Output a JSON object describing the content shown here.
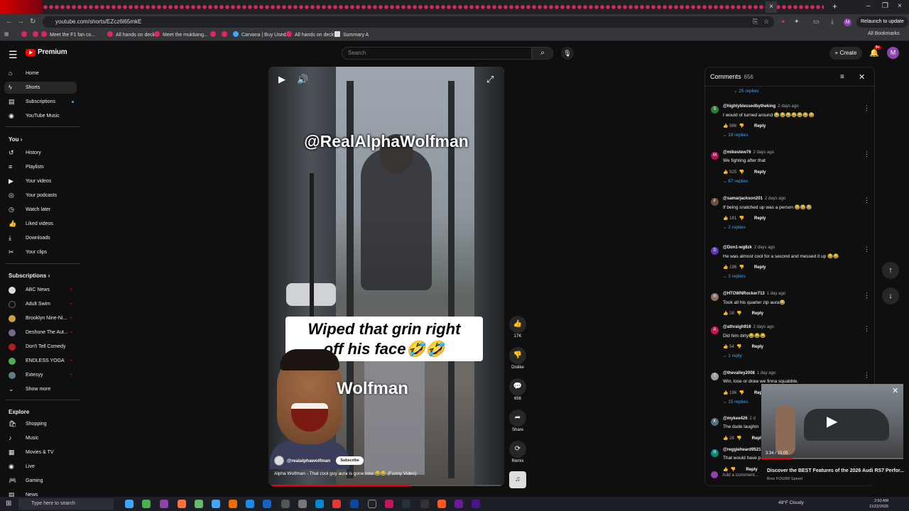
{
  "browser": {
    "url": "youtube.com/shorts/EZcz6l65mkE",
    "relaunch": "Relaunch to update",
    "profile": "M",
    "bookmarks": [
      "Meet the F1 fan co...",
      "All hands on deck",
      "Meet the mukbang...",
      "Carvana | Buy Used...",
      "All hands on deck",
      "Summary A"
    ],
    "all_bookmarks": "All Bookmarks"
  },
  "header": {
    "brand": "Premium",
    "search_placeholder": "Search",
    "create": "Create",
    "notif_count": "9+",
    "avatar": "M"
  },
  "sidebar": {
    "main": [
      "Home",
      "Shorts",
      "Subscriptions",
      "YouTube Music"
    ],
    "you_heading": "You",
    "you": [
      "History",
      "Playlists",
      "Your videos",
      "Your podcasts",
      "Watch later",
      "Liked videos",
      "Downloads",
      "Your clips"
    ],
    "subs_heading": "Subscriptions",
    "subs": [
      "ABC News",
      "Adult Swim",
      "Brooklyn Nine-Ni...",
      "Deshone The Aut...",
      "Don't Tell Comedy",
      "ENDLESS YOGA",
      "Extesyy"
    ],
    "show_more": "Show more",
    "explore_heading": "Explore",
    "explore": [
      "Shopping",
      "Music",
      "Movies & TV",
      "Live",
      "Gaming",
      "News"
    ]
  },
  "short": {
    "watermark": "@RealAlphaWolfman",
    "caption_line1": "Wiped that grin right",
    "caption_line2": "off his face🤣🤣",
    "overlay_name": "Wolfman",
    "channel": "@realalphawolfman",
    "subscribe": "Subscribe",
    "title": "Alpha Wolfman - That cool guy aura is gone now 😂😂 (Funny Video)",
    "progress": 0.6
  },
  "actions": {
    "likes": "17K",
    "dislike": "Dislike",
    "comments": "656",
    "share": "Share",
    "remix": "Remix"
  },
  "comments": {
    "title": "Comments",
    "count": "656",
    "reply_label": "Reply",
    "add_placeholder": "Add a comment...",
    "top_replies": "25 replies",
    "items": [
      {
        "user": "@highlyblessedbytheking",
        "age": "2 days ago",
        "text": "I would of turned around 😂😂😂😂😂😂😂",
        "likes": "986",
        "replies": "19 replies",
        "avatar": "S",
        "color": "#2e7d32"
      },
      {
        "user": "@mikestew76",
        "age": "2 days ago",
        "text": "We fighting after that",
        "likes": "925",
        "replies": "67 replies",
        "avatar": "M",
        "color": "#ad1457"
      },
      {
        "user": "@samarjackson201",
        "age": "2 days ago",
        "text": "If being snatched up was a person 😂😂😂",
        "likes": "181",
        "replies": "2 replies",
        "avatar": "F",
        "color": "#6d4c41"
      },
      {
        "user": "@Don1-wg8zk",
        "age": "2 days ago",
        "text": "He was almost cool for a second and messed it up 😂😂",
        "likes": "198",
        "replies": "3 replies",
        "avatar": "D",
        "color": "#5e35b1"
      },
      {
        "user": "@HTOWNRocker713",
        "age": "1 day ago",
        "text": "Took all his quarter zip aura😂",
        "likes": "28",
        "replies": "",
        "avatar": "H",
        "color": "#8d6e63"
      },
      {
        "user": "@athraigh916",
        "age": "2 days ago",
        "text": "Did him dirty😂😂😂",
        "likes": "54",
        "replies": "1 reply",
        "avatar": "A",
        "color": "#c2185b"
      },
      {
        "user": "@thevalley2008",
        "age": "1 day ago",
        "text": "Win, lose or draw we finna squabble.",
        "likes": "196",
        "replies": "15 replies",
        "avatar": "T",
        "color": "#9e9e9e"
      },
      {
        "user": "@mykee426",
        "age": "2 d",
        "text": "The dude laughin",
        "likes": "26",
        "replies": "",
        "avatar": "K",
        "color": "#546e7a"
      },
      {
        "user": "@reggieheard9521",
        "age": "",
        "text": "That would have p",
        "likes": "",
        "replies": "",
        "avatar": "R",
        "color": "#00897b"
      }
    ]
  },
  "miniplayer": {
    "time": "3:34 / 15:05",
    "title": "Discover the BEST Features of the 2026 Audi RS7 Perfor...",
    "channel": "Bros FOURR Speed",
    "progress": 0.22
  },
  "taskbar": {
    "search": "Type here to search",
    "weather": "48°F Cloudy",
    "time": "2:50 AM",
    "date": "11/22/2025"
  }
}
